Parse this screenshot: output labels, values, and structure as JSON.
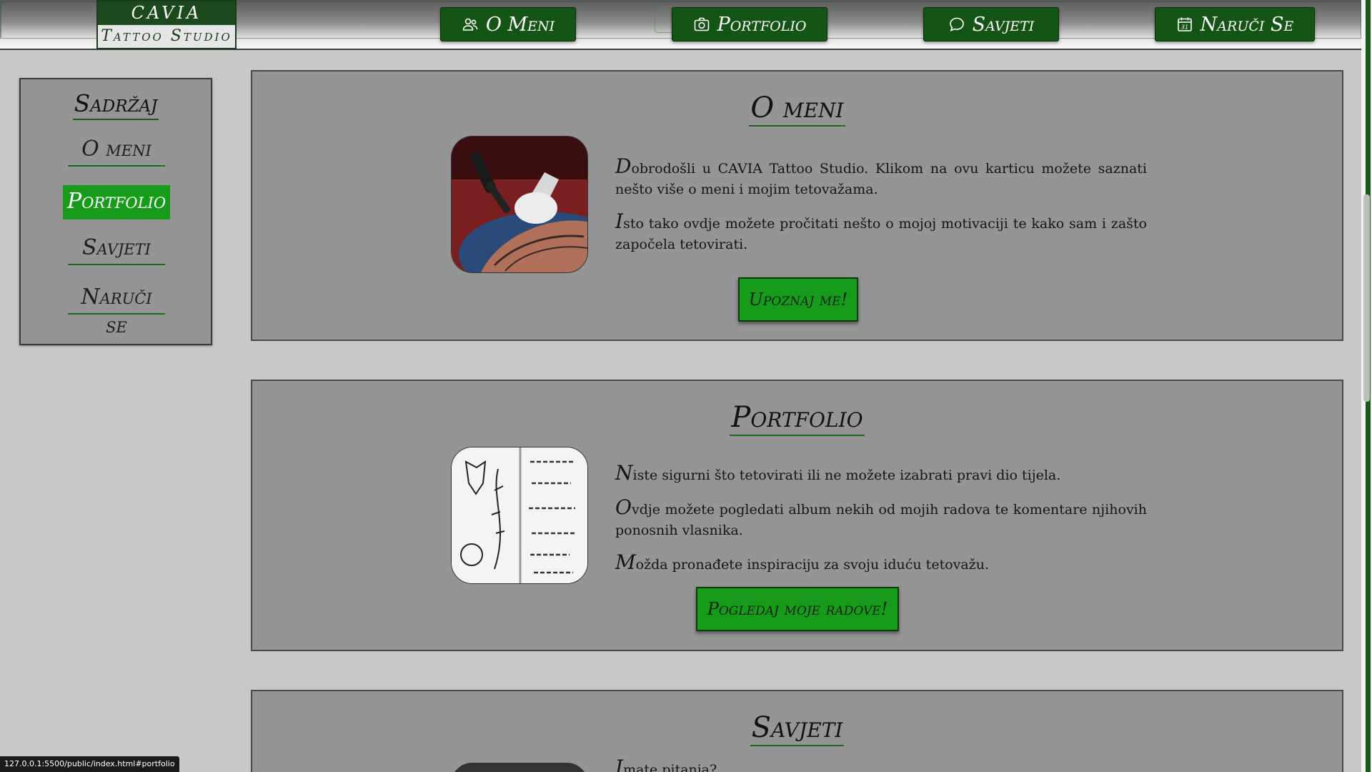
{
  "brand": {
    "line1": "CAVIA",
    "line2": "Tattoo Studio"
  },
  "nav": [
    {
      "label": "O Meni",
      "icon": "people-icon"
    },
    {
      "label": "Portfolio",
      "icon": "camera-icon"
    },
    {
      "label": "Savjeti",
      "icon": "chat-icon"
    },
    {
      "label": "Naruči Se",
      "icon": "calendar-icon"
    }
  ],
  "sidebar": {
    "title": "Sadržaj",
    "items": [
      {
        "label": "O meni",
        "active": false
      },
      {
        "label": "Portfolio",
        "active": true
      },
      {
        "label": "Savjeti",
        "active": false
      },
      {
        "label": "Naruči se",
        "active": false
      }
    ]
  },
  "sections": {
    "about": {
      "title": "O meni",
      "paragraphs": [
        {
          "cap": "D",
          "text": "obrodošli u CAVIA Tattoo Studio. Klikom na ovu karticu možete saznati nešto više o meni i mojim tetovažama."
        },
        {
          "cap": "I",
          "text": "sto tako ovdje možete pročitati nešto o mojoj motivaciji te kako sam i zašto započela tetovirati."
        }
      ],
      "button": "Upoznaj me!"
    },
    "portfolio": {
      "title": "Portfolio",
      "paragraphs": [
        {
          "cap": "N",
          "text": "iste sigurni što tetovirati ili ne možete izabrati pravi dio tijela."
        },
        {
          "cap": "O",
          "text": "vdje možete pogledati album nekih od mojih radova te komentare njihovih ponosnih vlasnika."
        },
        {
          "cap": "M",
          "text": "ožda pronađete inspiraciju za svoju iduću tetovažu."
        }
      ],
      "button": "Pogledaj moje radove!"
    },
    "tips": {
      "title": "Savjeti",
      "paragraphs": [
        {
          "cap": "I",
          "text": "mate pitanja?"
        }
      ]
    }
  },
  "status_url": "127.0.0.1:5500/public/index.html#portfolio",
  "colors": {
    "accent": "#169c1a",
    "dark_green": "#145414",
    "panel": "#959595",
    "page_bg": "#c8c8c8"
  }
}
